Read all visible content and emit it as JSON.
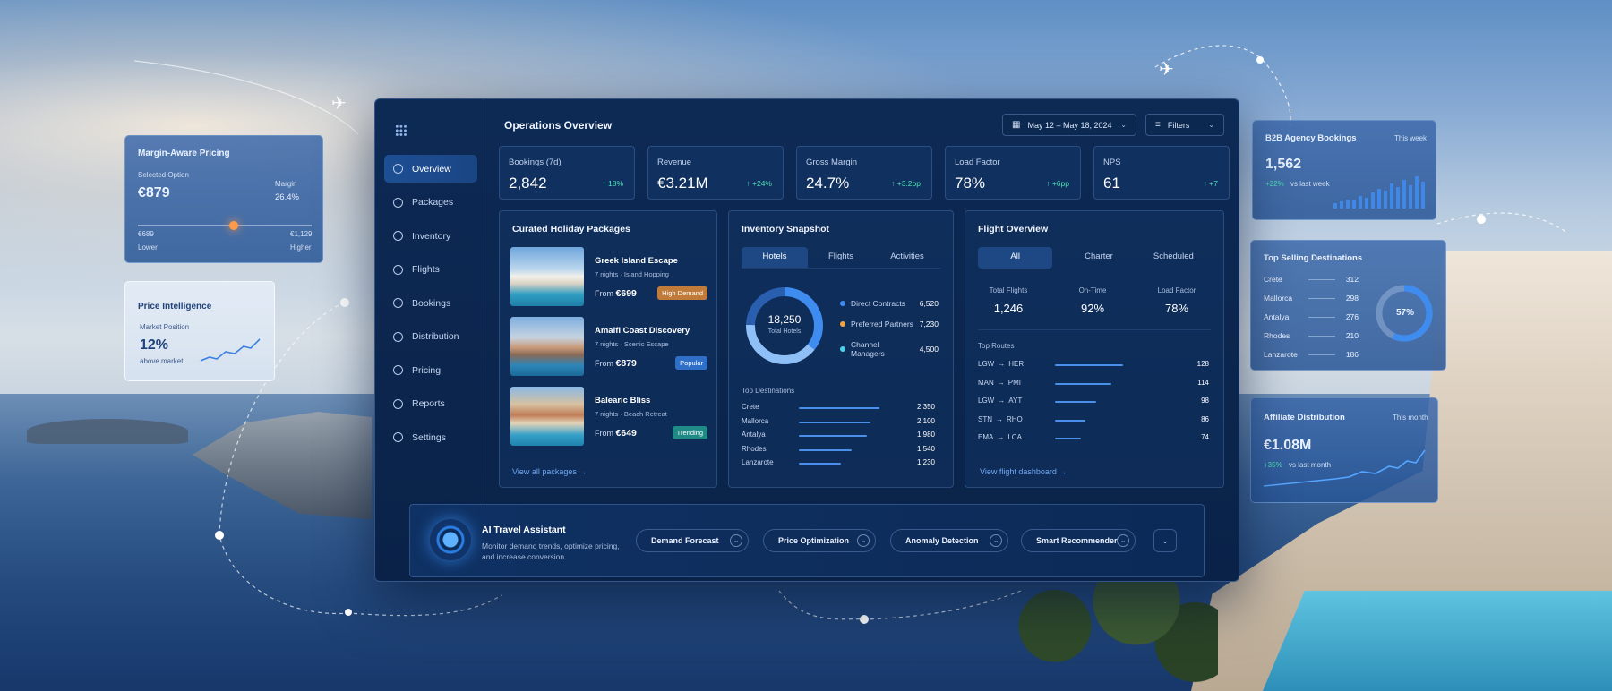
{
  "nav": {
    "items": [
      {
        "label": "Overview",
        "icon": "dollar-circle-icon",
        "name": "overview"
      },
      {
        "label": "Packages",
        "icon": "package-icon",
        "name": "packages"
      },
      {
        "label": "Inventory",
        "icon": "inventory-icon",
        "name": "inventory"
      },
      {
        "label": "Flights",
        "icon": "plane-icon",
        "name": "flights"
      },
      {
        "label": "Bookings",
        "icon": "calendar-icon",
        "name": "bookings"
      },
      {
        "label": "Distribution",
        "icon": "share-icon",
        "name": "distribution"
      },
      {
        "label": "Pricing",
        "icon": "tag-icon",
        "name": "pricing"
      },
      {
        "label": "Reports",
        "icon": "report-icon",
        "name": "reports"
      },
      {
        "label": "Settings",
        "icon": "gear-icon",
        "name": "settings"
      }
    ]
  },
  "header": {
    "title": "Operations Overview",
    "date_range": "May 12 – May 18, 2024",
    "filters": "Filters"
  },
  "kpis": [
    {
      "label": "Bookings (7d)",
      "value": "2,842",
      "delta": "↑ 18%"
    },
    {
      "label": "Revenue",
      "value": "€3.21M",
      "delta": "↑ +24%"
    },
    {
      "label": "Gross Margin",
      "value": "24.7%",
      "delta": "↑ +3.2pp"
    },
    {
      "label": "Load Factor",
      "value": "78%",
      "delta": "↑ +6pp"
    },
    {
      "label": "NPS",
      "value": "61",
      "delta": "↑ +7"
    }
  ],
  "packages": {
    "title": "Curated Holiday Packages",
    "items": [
      {
        "name": "Greek Island Escape",
        "sub": "7 nights · Island Hopping",
        "price_prefix": "From",
        "price": "€699",
        "tag": "High Demand",
        "tag_color": "#c07a3a"
      },
      {
        "name": "Amalfi Coast Discovery",
        "sub": "7 nights · Scenic Escape",
        "price_prefix": "From",
        "price": "€879",
        "tag": "Popular",
        "tag_color": "#2f6fc8"
      },
      {
        "name": "Balearic Bliss",
        "sub": "7 nights · Beach Retreat",
        "price_prefix": "From",
        "price": "€649",
        "tag": "Trending",
        "tag_color": "#1f8a86"
      }
    ],
    "link": "View all packages →"
  },
  "inventory": {
    "title": "Inventory Snapshot",
    "tabs": [
      "Hotels",
      "Flights",
      "Activities"
    ],
    "donut_value": "18,250",
    "donut_label": "Total Hotels",
    "legend": [
      {
        "label": "Direct Contracts",
        "value": "6,520",
        "color": "#3f8cf0"
      },
      {
        "label": "Preferred Partners",
        "value": "7,230",
        "color": "#f0a640"
      },
      {
        "label": "Channel Managers",
        "value": "4,500",
        "color": "#4fd0e8"
      }
    ],
    "donut_fractions": [
      0.357,
      0.396,
      0.247
    ],
    "dest_title": "Top Destinations",
    "destinations": [
      {
        "name": "Crete",
        "value": "2,350",
        "ratio": 1.0
      },
      {
        "name": "Mallorca",
        "value": "2,100",
        "ratio": 0.89
      },
      {
        "name": "Antalya",
        "value": "1,980",
        "ratio": 0.84
      },
      {
        "name": "Rhodes",
        "value": "1,540",
        "ratio": 0.66
      },
      {
        "name": "Lanzarote",
        "value": "1,230",
        "ratio": 0.52
      }
    ]
  },
  "flights": {
    "title": "Flight Overview",
    "tabs": [
      "All",
      "Charter",
      "Scheduled"
    ],
    "stats": [
      {
        "label": "Total Flights",
        "value": "1,246"
      },
      {
        "label": "On-Time",
        "value": "92%"
      },
      {
        "label": "Load Factor",
        "value": "78%"
      }
    ],
    "routes_title": "Top Routes",
    "routes": [
      {
        "from": "LGW",
        "to": "HER",
        "value": "128",
        "ratio": 1.0
      },
      {
        "from": "MAN",
        "to": "PMI",
        "value": "114",
        "ratio": 0.83
      },
      {
        "from": "LGW",
        "to": "AYT",
        "value": "98",
        "ratio": 0.6
      },
      {
        "from": "STN",
        "to": "RHO",
        "value": "86",
        "ratio": 0.45
      },
      {
        "from": "EMA",
        "to": "LCA",
        "value": "74",
        "ratio": 0.38
      }
    ],
    "link": "View flight dashboard →"
  },
  "assistant": {
    "title": "AI Travel Assistant",
    "desc": "Monitor demand trends, optimize pricing, and increase conversion.",
    "pills": [
      "Demand Forecast",
      "Price Optimization",
      "Anomaly Detection",
      "Smart Recommender"
    ]
  },
  "margin_card": {
    "title": "Margin-Aware Pricing",
    "selected_label": "Selected Option",
    "price": "€879",
    "margin_label": "Margin",
    "margin": "26.4%",
    "low_value": "€689",
    "high_value": "€1,129",
    "low_label": "Lower",
    "high_label": "Higher",
    "slider_position": 0.55
  },
  "price_card": {
    "title": "Price Intelligence",
    "position_label": "Market Position",
    "value": "12%",
    "value_label": "above market"
  },
  "b2b_card": {
    "title": "B2B Agency Bookings",
    "period": "This week",
    "value": "1,562",
    "delta": "+22%",
    "delta_label": "vs last week"
  },
  "top_selling": {
    "title": "Top Selling Destinations",
    "items": [
      {
        "name": "Crete",
        "value": "312"
      },
      {
        "name": "Mallorca",
        "value": "298"
      },
      {
        "name": "Antalya",
        "value": "276"
      },
      {
        "name": "Rhodes",
        "value": "210"
      },
      {
        "name": "Lanzarote",
        "value": "186"
      }
    ],
    "donut_value": "57%",
    "donut_fraction": 0.57
  },
  "affiliate_card": {
    "title": "Affiliate Distribution",
    "period": "This month",
    "value": "€1.08M",
    "delta": "+35%",
    "delta_label": "vs last month"
  },
  "colors": {
    "accent": "#3f8cf0",
    "positive": "#4fe0b4",
    "panel": "#0d2a55"
  }
}
